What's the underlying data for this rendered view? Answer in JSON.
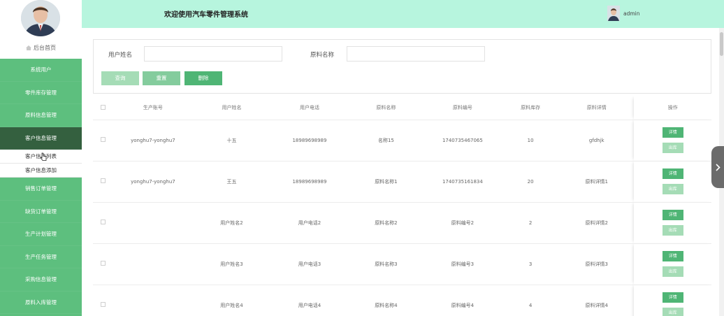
{
  "sidebar": {
    "home_label": "后台首页",
    "menu": [
      {
        "label": "系统用户"
      },
      {
        "label": "零件库存管理"
      },
      {
        "label": "原料信息管理"
      },
      {
        "label": "客户信息管理"
      }
    ],
    "submenu": [
      {
        "label": "客户信息列表"
      },
      {
        "label": "客户信息添加"
      }
    ],
    "menu_after": [
      {
        "label": "销售订单管理"
      },
      {
        "label": "缺货订单管理"
      },
      {
        "label": "生产计划管理"
      },
      {
        "label": "生产任务管理"
      },
      {
        "label": "采购信息管理"
      },
      {
        "label": "原料入库管理"
      }
    ]
  },
  "header": {
    "title": "欢迎使用汽车零件管理系统",
    "user_name": "admin"
  },
  "search": {
    "field1_label": "用户姓名",
    "field1_value": "",
    "field2_label": "原料名称",
    "field2_value": "",
    "btn_query": "查询",
    "btn_reset": "重置",
    "btn_delete": "删除"
  },
  "table": {
    "columns": [
      "生产账号",
      "用户姓名",
      "用户电话",
      "原料名称",
      "原料编号",
      "原料库存",
      "原料详情",
      "操作"
    ],
    "rows": [
      {
        "account": "yonghu7-yonghu7",
        "name": "十五",
        "phone": "18989698989",
        "material": "名称15",
        "code": "1740735467065",
        "stock": "10",
        "detail": "gfdhjk"
      },
      {
        "account": "yonghu7-yonghu7",
        "name": "王五",
        "phone": "18989698989",
        "material": "原料名称1",
        "code": "1740735161834",
        "stock": "20",
        "detail": "原料详情1"
      },
      {
        "account": "",
        "name": "用户姓名2",
        "phone": "用户电话2",
        "material": "原料名称2",
        "code": "原料编号2",
        "stock": "2",
        "detail": "原料详情2"
      },
      {
        "account": "",
        "name": "用户姓名3",
        "phone": "用户电话3",
        "material": "原料名称3",
        "code": "原料编号3",
        "stock": "3",
        "detail": "原料详情3"
      },
      {
        "account": "",
        "name": "用户姓名4",
        "phone": "用户电话4",
        "material": "原料名称4",
        "code": "原料编号4",
        "stock": "4",
        "detail": "原料详情4"
      }
    ],
    "btn_detail": "详情",
    "btn_out": "出库"
  },
  "colors": {
    "sidebar_bg": "#5dbf7e",
    "sidebar_active": "#34603f",
    "header_bg": "#b7f5de",
    "primary_button": "#4fb575",
    "light_button": "#a5dcb6"
  },
  "icons": [
    "home-icon",
    "chevron-right-icon",
    "pointer-cursor-icon"
  ]
}
